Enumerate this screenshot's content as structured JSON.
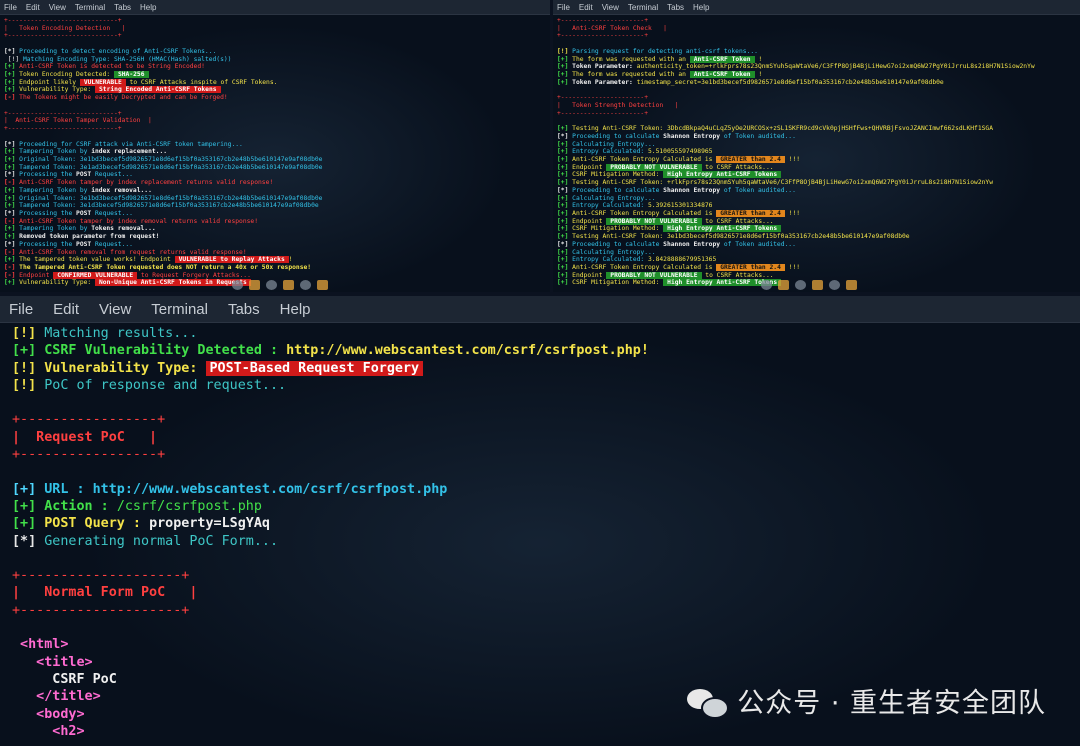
{
  "menu": [
    "File",
    "Edit",
    "View",
    "Terminal",
    "Tabs",
    "Help"
  ],
  "win1": {
    "lines": [
      [
        {
          "t": "+-----------------------------+",
          "c": "t-r"
        }
      ],
      [
        {
          "t": "|   Token Encoding Detection   |",
          "c": "t-r"
        }
      ],
      [
        {
          "t": "+-----------------------------+",
          "c": "t-r"
        }
      ],
      [
        {
          "t": " ",
          "c": "t-w"
        }
      ],
      [
        {
          "t": "[*] ",
          "c": "tag-w"
        },
        {
          "t": "Proceeding to detect encoding of Anti-CSRF Tokens...",
          "c": "t-c"
        }
      ],
      [
        {
          "t": " [!] ",
          "c": "t-w"
        },
        {
          "t": "Matching Encoding Type: SHA-256H (HMAC(Hash) salted(s))",
          "c": "t-c"
        }
      ],
      [
        {
          "t": "[+] ",
          "c": "tag-g"
        },
        {
          "t": "Anti-CSRF Token is detected to be String Encoded!",
          "c": "t-r"
        }
      ],
      [
        {
          "t": "[+] ",
          "c": "tag-g"
        },
        {
          "t": "Token Encoding Detected: ",
          "c": "t-y"
        },
        {
          "t": "SHA-256",
          "c": "hl hl-green"
        }
      ],
      [
        {
          "t": "[+] ",
          "c": "tag-g"
        },
        {
          "t": "Endpoint likely ",
          "c": "t-y"
        },
        {
          "t": "VULNERABLE",
          "c": "hl hl-red"
        },
        {
          "t": " to CSRF Attacks inspite of CSRF Tokens.",
          "c": "t-y"
        }
      ],
      [
        {
          "t": "[+] ",
          "c": "tag-g"
        },
        {
          "t": "Vulnerability Type: ",
          "c": "t-y"
        },
        {
          "t": "String Encoded Anti-CSRF Tokens",
          "c": "hl hl-red"
        }
      ],
      [
        {
          "t": "[-] ",
          "c": "tag-r"
        },
        {
          "t": "The Tokens might be easily Decrypted and can be Forged!",
          "c": "t-r"
        }
      ],
      [
        {
          "t": " ",
          "c": "t-w"
        }
      ],
      [
        {
          "t": "+-----------------------------+",
          "c": "t-r"
        }
      ],
      [
        {
          "t": "|  Anti-CSRF Token Tamper Validation  |",
          "c": "t-r"
        }
      ],
      [
        {
          "t": "+-----------------------------+",
          "c": "t-r"
        }
      ],
      [
        {
          "t": " ",
          "c": "t-w"
        }
      ],
      [
        {
          "t": "[*] ",
          "c": "tag-w"
        },
        {
          "t": "Proceeding for CSRF attack via Anti-CSRF token tampering...",
          "c": "t-c"
        }
      ],
      [
        {
          "t": "[+] ",
          "c": "tag-g"
        },
        {
          "t": "Tampering Token by ",
          "c": "t-c"
        },
        {
          "t": "index replacement...",
          "c": "t-w bold"
        }
      ],
      [
        {
          "t": "[+] ",
          "c": "tag-g"
        },
        {
          "t": "Original Token: ",
          "c": "t-c"
        },
        {
          "t": "3e1bd3becef5d9826571e8d6ef15bf0a353167cb2e48b5be610147e9af08db0e",
          "c": "t-c"
        }
      ],
      [
        {
          "t": "[+] ",
          "c": "tag-g"
        },
        {
          "t": "Tampered Token: ",
          "c": "t-c"
        },
        {
          "t": "3e1ad3becef5d9826571e8d6ef15bf0a353167cb2e48b5be610147e9af08db0e",
          "c": "t-c"
        }
      ],
      [
        {
          "t": "[*] ",
          "c": "tag-w"
        },
        {
          "t": "Processing the ",
          "c": "t-c"
        },
        {
          "t": "POST",
          "c": "t-w bold"
        },
        {
          "t": " Request...",
          "c": "t-c"
        }
      ],
      [
        {
          "t": "[-] ",
          "c": "tag-r"
        },
        {
          "t": "Anti-CSRF Token tamper by index replacement returns valid response!",
          "c": "t-r"
        }
      ],
      [
        {
          "t": "[+] ",
          "c": "tag-g"
        },
        {
          "t": "Tampering Token by ",
          "c": "t-c"
        },
        {
          "t": "index removal...",
          "c": "t-w bold"
        }
      ],
      [
        {
          "t": "[+] ",
          "c": "tag-g"
        },
        {
          "t": "Original Token: ",
          "c": "t-c"
        },
        {
          "t": "3e1bd3becef5d9826571e8d6ef15bf0a353167cb2e48b5be610147e9af08db0e",
          "c": "t-c"
        }
      ],
      [
        {
          "t": "[+] ",
          "c": "tag-g"
        },
        {
          "t": "Tampered Token: ",
          "c": "t-c"
        },
        {
          "t": "3e1d3becef5d9826571e8d6ef15bf0a353167cb2e48b5be610147e9af08db0e",
          "c": "t-c"
        }
      ],
      [
        {
          "t": "[*] ",
          "c": "tag-w"
        },
        {
          "t": "Processing the ",
          "c": "t-c"
        },
        {
          "t": "POST",
          "c": "t-w bold"
        },
        {
          "t": " Request...",
          "c": "t-c"
        }
      ],
      [
        {
          "t": "[-] ",
          "c": "tag-r"
        },
        {
          "t": "Anti-CSRF Token tamper by index removal returns valid response!",
          "c": "t-r"
        }
      ],
      [
        {
          "t": "[+] ",
          "c": "tag-g"
        },
        {
          "t": "Tampering Token by ",
          "c": "t-c"
        },
        {
          "t": "Tokens removal...",
          "c": "t-w bold"
        }
      ],
      [
        {
          "t": "[+] ",
          "c": "tag-g"
        },
        {
          "t": "Removed token parameter from request!",
          "c": "t-w bold"
        }
      ],
      [
        {
          "t": "[*] ",
          "c": "tag-w"
        },
        {
          "t": "Processing the ",
          "c": "t-c"
        },
        {
          "t": "POST",
          "c": "t-w bold"
        },
        {
          "t": " Request...",
          "c": "t-c"
        }
      ],
      [
        {
          "t": "[-] ",
          "c": "tag-r"
        },
        {
          "t": "Anti-CSRF Token removal from request returns valid response!",
          "c": "t-r"
        }
      ],
      [
        {
          "t": "[+] ",
          "c": "tag-g"
        },
        {
          "t": "The tampered token value works! Endpoint ",
          "c": "t-y"
        },
        {
          "t": "VULNERABLE to Replay Attacks",
          "c": "hl hl-red"
        },
        {
          "t": "!",
          "c": "t-y"
        }
      ],
      [
        {
          "t": "[-] ",
          "c": "tag-r"
        },
        {
          "t": "The Tampered Anti-CSRF Token requested does NOT return a 40x or 50x response!",
          "c": "t-y bold"
        }
      ],
      [
        {
          "t": "[-] ",
          "c": "tag-r"
        },
        {
          "t": "Endpoint ",
          "c": "t-r"
        },
        {
          "t": "CONFIRMED VULNERABLE",
          "c": "hl hl-red"
        },
        {
          "t": " to Request Forgery Attacks...",
          "c": "t-r"
        }
      ],
      [
        {
          "t": "[+] ",
          "c": "tag-g"
        },
        {
          "t": "Vulnerability Type: ",
          "c": "t-y"
        },
        {
          "t": "Non-Unique Anti-CSRF Tokens in Requests",
          "c": "hl hl-red"
        }
      ]
    ]
  },
  "win2": {
    "lines": [
      [
        {
          "t": "+----------------------+",
          "c": "t-r"
        }
      ],
      [
        {
          "t": "|   Anti-CSRF Token Check   |",
          "c": "t-r"
        }
      ],
      [
        {
          "t": "+----------------------+",
          "c": "t-r"
        }
      ],
      [
        {
          "t": " ",
          "c": "t-w"
        }
      ],
      [
        {
          "t": "[!] ",
          "c": "tag-y"
        },
        {
          "t": "Parsing request for detecting anti-csrf tokens...",
          "c": "t-c"
        }
      ],
      [
        {
          "t": "[+] ",
          "c": "tag-g"
        },
        {
          "t": "The form was requested with an ",
          "c": "t-y"
        },
        {
          "t": "Anti-CSRF Token",
          "c": "hl hl-green"
        },
        {
          "t": " !",
          "c": "t-y"
        }
      ],
      [
        {
          "t": "[+] ",
          "c": "tag-g"
        },
        {
          "t": "Token Parameter: ",
          "c": "t-w bold"
        },
        {
          "t": "authenticity_token=+rlkFprs78s23QnmSYuh5qaWtaVe6/C3FfP8OjB4BjLiHewG7oi2xmQ6W27PgY0iJrruL8s2i8H7N1Siow2nYw",
          "c": "t-y"
        }
      ],
      [
        {
          "t": "[+] ",
          "c": "tag-g"
        },
        {
          "t": "The form was requested with an ",
          "c": "t-y"
        },
        {
          "t": "Anti-CSRF Token",
          "c": "hl hl-green"
        },
        {
          "t": " !",
          "c": "t-y"
        }
      ],
      [
        {
          "t": "[+] ",
          "c": "tag-g"
        },
        {
          "t": "Token Parameter: ",
          "c": "t-w bold"
        },
        {
          "t": "timestamp_secret=3e1bd3becef5d9826571e8d6ef15bf0a353167cb2e48b5be610147e9af08db0e",
          "c": "t-y"
        }
      ],
      [
        {
          "t": " ",
          "c": "t-w"
        }
      ],
      [
        {
          "t": "+----------------------+",
          "c": "t-r"
        }
      ],
      [
        {
          "t": "|   Token Strength Detection   |",
          "c": "t-r"
        }
      ],
      [
        {
          "t": "+----------------------+",
          "c": "t-r"
        }
      ],
      [
        {
          "t": " ",
          "c": "t-w"
        }
      ],
      [
        {
          "t": "[+] ",
          "c": "tag-g"
        },
        {
          "t": "Testing Anti-CSRF Token: ",
          "c": "t-y"
        },
        {
          "t": "3DbcdBkpaQ4uCLqZ5yOe2URCOSx+zSL1SKFR9cd9cVk0pjHSHfFws+QHVRBjFsvoJZANCImwf662sdLKHf1SGA",
          "c": "t-y"
        }
      ],
      [
        {
          "t": "[*] ",
          "c": "tag-w"
        },
        {
          "t": "Proceeding to calculate ",
          "c": "t-c"
        },
        {
          "t": "Shannon Entropy",
          "c": "t-w bold"
        },
        {
          "t": " of Token audited...",
          "c": "t-c"
        }
      ],
      [
        {
          "t": "[+] ",
          "c": "tag-g"
        },
        {
          "t": "Calculating Entropy...",
          "c": "t-c"
        }
      ],
      [
        {
          "t": "[+] ",
          "c": "tag-g"
        },
        {
          "t": "Entropy Calculated: ",
          "c": "t-c"
        },
        {
          "t": "5.510055597498965",
          "c": "t-y"
        }
      ],
      [
        {
          "t": "[+] ",
          "c": "tag-g"
        },
        {
          "t": "Anti-CSRF Token Entropy Calculated is ",
          "c": "t-y"
        },
        {
          "t": "GREATER than 2.4",
          "c": "hl hl-orange"
        },
        {
          "t": " !!!",
          "c": "t-y"
        }
      ],
      [
        {
          "t": "[+] ",
          "c": "tag-g"
        },
        {
          "t": "Endpoint ",
          "c": "t-y"
        },
        {
          "t": "PROBABLY NOT VULNERABLE",
          "c": "hl hl-green"
        },
        {
          "t": " to CSRF Attacks...",
          "c": "t-y"
        }
      ],
      [
        {
          "t": "[+] ",
          "c": "tag-g"
        },
        {
          "t": "CSRF Mitigation Method: ",
          "c": "t-y"
        },
        {
          "t": "High Entropy Anti-CSRF Tokens",
          "c": "hl hl-green"
        }
      ],
      [
        {
          "t": "[+] ",
          "c": "tag-g"
        },
        {
          "t": "Testing Anti-CSRF Token: ",
          "c": "t-y"
        },
        {
          "t": "+rlkFprs78s23QnmSYuh5qaWtaVe6/C3FfP8OjB4BjLiHewG7oi2xmQ6W27PgY0iJrruL8s2i8H7N1Siow2nYw",
          "c": "t-y"
        }
      ],
      [
        {
          "t": "[*] ",
          "c": "tag-w"
        },
        {
          "t": "Proceeding to calculate ",
          "c": "t-c"
        },
        {
          "t": "Shannon Entropy",
          "c": "t-w bold"
        },
        {
          "t": " of Token audited...",
          "c": "t-c"
        }
      ],
      [
        {
          "t": "[+] ",
          "c": "tag-g"
        },
        {
          "t": "Calculating Entropy...",
          "c": "t-c"
        }
      ],
      [
        {
          "t": "[+] ",
          "c": "tag-g"
        },
        {
          "t": "Entropy Calculated: ",
          "c": "t-c"
        },
        {
          "t": "5.392615301334876",
          "c": "t-y"
        }
      ],
      [
        {
          "t": "[+] ",
          "c": "tag-g"
        },
        {
          "t": "Anti-CSRF Token Entropy Calculated is ",
          "c": "t-y"
        },
        {
          "t": "GREATER than 2.4",
          "c": "hl hl-orange"
        },
        {
          "t": " !!!",
          "c": "t-y"
        }
      ],
      [
        {
          "t": "[+] ",
          "c": "tag-g"
        },
        {
          "t": "Endpoint ",
          "c": "t-y"
        },
        {
          "t": "PROBABLY NOT VULNERABLE",
          "c": "hl hl-green"
        },
        {
          "t": " to CSRF Attacks...",
          "c": "t-y"
        }
      ],
      [
        {
          "t": "[+] ",
          "c": "tag-g"
        },
        {
          "t": "CSRF Mitigation Method: ",
          "c": "t-y"
        },
        {
          "t": "High Entropy Anti-CSRF Tokens",
          "c": "hl hl-green"
        }
      ],
      [
        {
          "t": "[+] ",
          "c": "tag-g"
        },
        {
          "t": "Testing Anti-CSRF Token: ",
          "c": "t-y"
        },
        {
          "t": "3e1bd3becef5d9826571e8d6ef15bf0a353167cb2e48b5be610147e9af08db0e",
          "c": "t-y"
        }
      ],
      [
        {
          "t": "[*] ",
          "c": "tag-w"
        },
        {
          "t": "Proceeding to calculate ",
          "c": "t-c"
        },
        {
          "t": "Shannon Entropy",
          "c": "t-w bold"
        },
        {
          "t": " of Token audited...",
          "c": "t-c"
        }
      ],
      [
        {
          "t": "[+] ",
          "c": "tag-g"
        },
        {
          "t": "Calculating Entropy...",
          "c": "t-c"
        }
      ],
      [
        {
          "t": "[+] ",
          "c": "tag-g"
        },
        {
          "t": "Entropy Calculated: ",
          "c": "t-c"
        },
        {
          "t": "3.8428888679951365",
          "c": "t-y"
        }
      ],
      [
        {
          "t": "[+] ",
          "c": "tag-g"
        },
        {
          "t": "Anti-CSRF Token Entropy Calculated is ",
          "c": "t-y"
        },
        {
          "t": "GREATER than 2.4",
          "c": "hl hl-orange"
        },
        {
          "t": " !!!",
          "c": "t-y"
        }
      ],
      [
        {
          "t": "[+] ",
          "c": "tag-g"
        },
        {
          "t": "Endpoint ",
          "c": "t-y"
        },
        {
          "t": "PROBABLY NOT VULNERABLE",
          "c": "hl hl-green"
        },
        {
          "t": " to CSRF Attacks...",
          "c": "t-y"
        }
      ],
      [
        {
          "t": "[+] ",
          "c": "tag-g"
        },
        {
          "t": "CSRF Mitigation Method: ",
          "c": "t-y"
        },
        {
          "t": "High Entropy Anti-CSRF Tokens",
          "c": "hl hl-green"
        }
      ]
    ]
  },
  "win3": {
    "lines": [
      [
        {
          "t": "[!] ",
          "c": "tag-y"
        },
        {
          "t": "Matching results...",
          "c": "t-m"
        }
      ],
      [
        {
          "t": "[+] ",
          "c": "tag-g"
        },
        {
          "t": "CSRF Vulnerability Detected : ",
          "c": "t-g bold"
        },
        {
          "t": "http://www.webscantest.com/csrf/csrfpost.php!",
          "c": "t-y bold"
        }
      ],
      [
        {
          "t": "[!] ",
          "c": "tag-y"
        },
        {
          "t": "Vulnerability Type: ",
          "c": "t-y bold"
        },
        {
          "t": "POST-Based Request Forgery",
          "c": "hl hl-red"
        }
      ],
      [
        {
          "t": "[!] ",
          "c": "tag-y"
        },
        {
          "t": "PoC of response and request...",
          "c": "t-m"
        }
      ],
      [
        {
          "t": " ",
          "c": "t-w"
        }
      ],
      [
        {
          "t": "+-----------------+",
          "c": "t-r"
        }
      ],
      [
        {
          "t": "|  Request PoC   |",
          "c": "t-r bold"
        }
      ],
      [
        {
          "t": "+-----------------+",
          "c": "t-r"
        }
      ],
      [
        {
          "t": " ",
          "c": "t-w"
        }
      ],
      [
        {
          "t": "[+] ",
          "c": "tag-c"
        },
        {
          "t": "URL : ",
          "c": "t-c bold"
        },
        {
          "t": "http://www.webscantest.com/csrf/csrfpost.php",
          "c": "t-c bold"
        }
      ],
      [
        {
          "t": "[+] ",
          "c": "tag-g"
        },
        {
          "t": "Action : ",
          "c": "t-g bold"
        },
        {
          "t": "/csrf/csrfpost.php",
          "c": "t-g"
        }
      ],
      [
        {
          "t": "[+] ",
          "c": "tag-g"
        },
        {
          "t": "POST Query : ",
          "c": "t-y bold"
        },
        {
          "t": "property=LSgYAq",
          "c": "t-w bold"
        }
      ],
      [
        {
          "t": "[*] ",
          "c": "tag-w"
        },
        {
          "t": "Generating normal PoC Form...",
          "c": "t-m"
        }
      ],
      [
        {
          "t": " ",
          "c": "t-w"
        }
      ],
      [
        {
          "t": "+--------------------+",
          "c": "t-r"
        }
      ],
      [
        {
          "t": "|   Normal Form PoC   |",
          "c": "t-r bold"
        }
      ],
      [
        {
          "t": "+--------------------+",
          "c": "t-r"
        }
      ],
      [
        {
          "t": " ",
          "c": "t-w"
        }
      ],
      [
        {
          "t": " <html>",
          "c": "t-p bold"
        }
      ],
      [
        {
          "t": "   <title>",
          "c": "t-p bold"
        }
      ],
      [
        {
          "t": "     CSRF PoC",
          "c": "t-w bold"
        }
      ],
      [
        {
          "t": "   </title>",
          "c": "t-p bold"
        }
      ],
      [
        {
          "t": "   <body>",
          "c": "t-p bold"
        }
      ],
      [
        {
          "t": "     <h2>",
          "c": "t-p bold"
        }
      ]
    ]
  },
  "watermark": "公众号 · 重生者安全团队"
}
